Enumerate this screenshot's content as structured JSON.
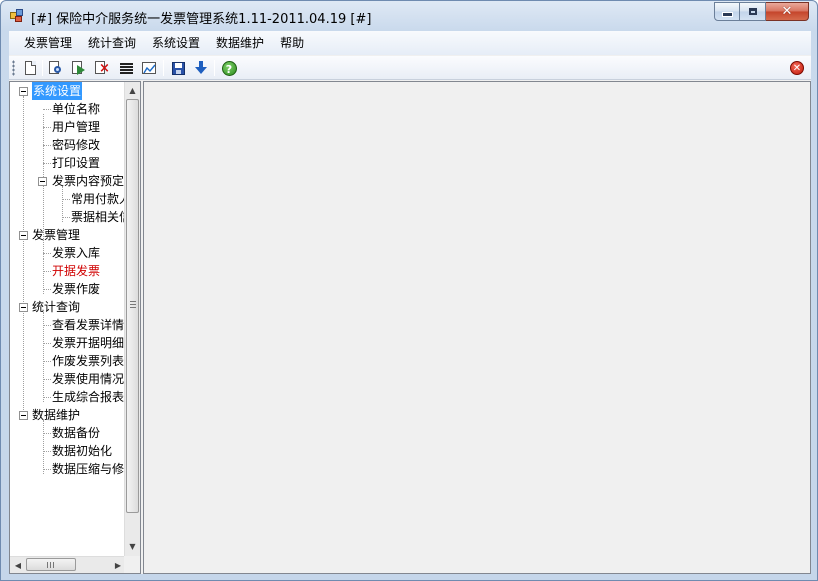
{
  "window": {
    "title": "[#] 保险中介服务统一发票管理系统1.11-2011.04.19 [#]",
    "controls": {
      "minimize": "minimize",
      "maximize": "maximize",
      "close": "✕"
    }
  },
  "menu": {
    "items": [
      "发票管理",
      "统计查询",
      "系统设置",
      "数据维护",
      "帮助"
    ]
  },
  "toolbar": {
    "buttons": [
      "new-icon",
      "find-icon",
      "export-icon",
      "delete-icon",
      "list-icon",
      "chart-icon",
      "save-icon",
      "download-icon",
      "help-icon"
    ],
    "help_glyph": "?",
    "close_glyph": "✕"
  },
  "tree": {
    "groups": [
      {
        "label": "系统设置",
        "selected": true,
        "children": [
          "单位名称",
          "用户管理",
          "密码修改",
          "打印设置"
        ],
        "subgroup": {
          "label": "发票内容预定",
          "children": [
            "常用付款人",
            "票据相关信息"
          ]
        }
      },
      {
        "label": "发票管理",
        "children": [
          "发票入库",
          "开据发票",
          "发票作废"
        ],
        "highlight": "开据发票"
      },
      {
        "label": "统计查询",
        "children": [
          "查看发票详情",
          "发票开据明细",
          "作废发票列表",
          "发票使用情况",
          "生成综合报表"
        ]
      },
      {
        "label": "数据维护",
        "children": [
          "数据备份",
          "数据初始化",
          "数据压缩与修复"
        ]
      }
    ],
    "scroll": {
      "up": "▲",
      "down": "▼",
      "left": "◀",
      "right": "▶"
    }
  },
  "colors": {
    "selection": "#3399ff",
    "highlight_text": "#d00000",
    "window_frame": "#c5d6ea",
    "client": "#f0f0f0"
  }
}
